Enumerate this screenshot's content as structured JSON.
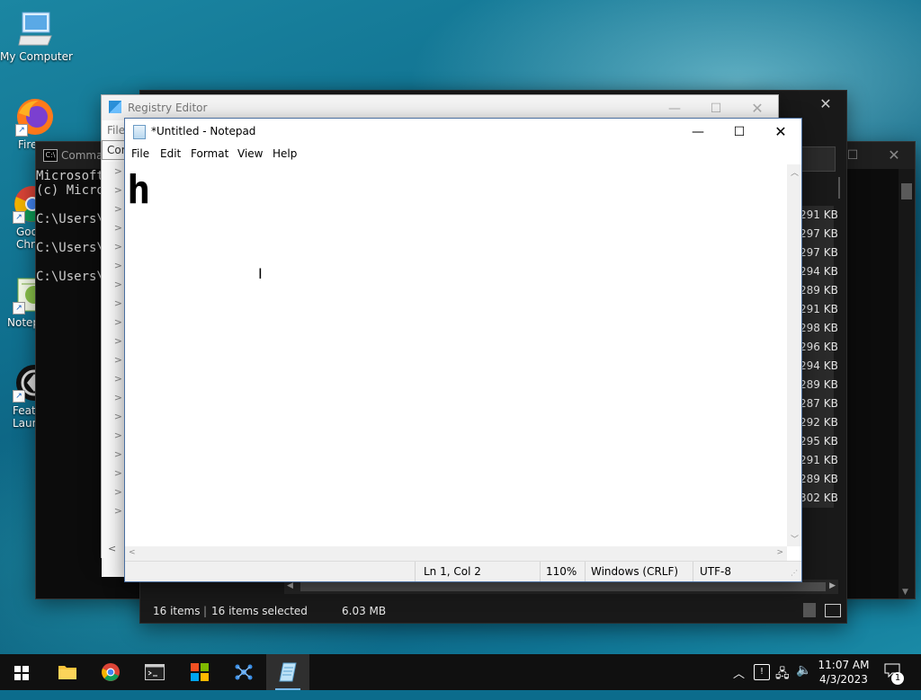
{
  "desktop": {
    "icons": [
      {
        "label": "My Computer",
        "icon": "computer-icon"
      },
      {
        "label": "Fire",
        "icon": "firefox-icon"
      },
      {
        "label": "Goo\nChro",
        "icon": "chrome-icon"
      },
      {
        "label": "Notep",
        "icon": "notepad-plus-plus-icon"
      },
      {
        "label": "Feat\nLaun",
        "icon": "feature-launcher-icon"
      }
    ]
  },
  "cmd": {
    "title": "Comma",
    "lines": [
      "Microsoft",
      "(c) Micro",
      "",
      "C:\\Users\\",
      "",
      "C:\\Users\\",
      "",
      "C:\\Users\\"
    ]
  },
  "explorer": {
    "sizes": [
      "291 KB",
      "297 KB",
      "297 KB",
      "294 KB",
      "289 KB",
      "291 KB",
      "298 KB",
      "296 KB",
      "294 KB",
      "289 KB",
      "287 KB",
      "292 KB",
      "295 KB",
      "291 KB",
      "289 KB",
      "302 KB"
    ],
    "status": {
      "count": "16 items",
      "selected": "16 items selected",
      "size": "6.03 MB"
    }
  },
  "regedit": {
    "title": "Registry Editor",
    "menu_file": "File",
    "address": "Con",
    "tree_arrows": [
      ">",
      ">",
      ">",
      ">",
      ">",
      ">",
      ">",
      ">",
      ">",
      ">",
      ">",
      ">",
      ">",
      ">",
      ">",
      ">",
      ">",
      ">",
      ">",
      ">"
    ]
  },
  "notepad": {
    "title": "*Untitled - Notepad",
    "menu": [
      "File",
      "Edit",
      "Format",
      "View",
      "Help"
    ],
    "content": "h",
    "status": {
      "position": "Ln 1, Col 2",
      "zoom": "110%",
      "line_ending": "Windows (CRLF)",
      "encoding": "UTF-8"
    }
  },
  "taskbar": {
    "apps": [
      "start-icon",
      "file-explorer-icon",
      "chrome-icon",
      "terminal-icon",
      "store-icon",
      "network-app-icon",
      "notepad-icon"
    ],
    "time": "11:07 AM",
    "date": "4/3/2023",
    "notification_count": "1"
  },
  "colors": {
    "accent": "#76b9ed",
    "taskbar": "#101010",
    "cmd_bg": "#0c0c0c"
  }
}
